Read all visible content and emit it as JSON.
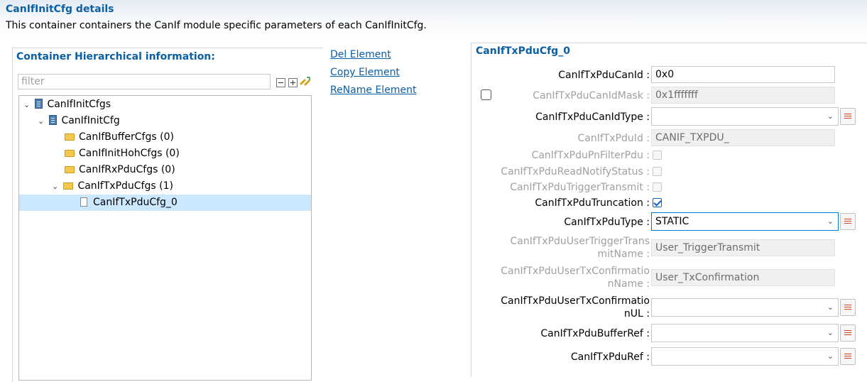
{
  "header": {
    "title": "CanIfInitCfg details",
    "description": "This container containers the CanIf module specific parameters of each CanIfInitCfg."
  },
  "tree_panel": {
    "header": "Container Hierarchical information:",
    "filter_placeholder": "filter",
    "toolbar_icons": [
      "collapse-all-icon",
      "expand-all-icon",
      "link-sync-icon"
    ],
    "items": [
      {
        "label": "CanIfInitCfgs",
        "icon": "config-module-icon",
        "expanded": true
      },
      {
        "label": "CanIfInitCfg",
        "icon": "config-module-icon",
        "expanded": true
      },
      {
        "label": "CanIfBufferCfgs (0)",
        "icon": "folder-icon"
      },
      {
        "label": "CanIfInitHohCfgs (0)",
        "icon": "folder-icon"
      },
      {
        "label": "CanIfRxPduCfgs (0)",
        "icon": "folder-icon"
      },
      {
        "label": "CanIfTxPduCfgs (1)",
        "icon": "folder-icon",
        "expanded": true
      },
      {
        "label": "CanIfTxPduCfg_0",
        "icon": "document-icon",
        "selected": true
      }
    ]
  },
  "actions": {
    "del": "Del Element",
    "copy": "Copy Element",
    "rename": "ReName Element"
  },
  "form": {
    "title": "CanIfTxPduCfg_0",
    "fields": {
      "can_id": {
        "label": "CanIfTxPduCanId :",
        "value": "0x0"
      },
      "can_id_mask": {
        "label": "CanIfTxPduCanIdMask :",
        "value": "0x1fffffff",
        "enabled": false,
        "checked": false
      },
      "can_id_type": {
        "label": "CanIfTxPduCanIdType :",
        "value": ""
      },
      "pdu_id": {
        "label": "CanIfTxPduId :",
        "value": "CANIF_TXPDU_",
        "enabled": false
      },
      "pn_filter": {
        "label": "CanIfTxPduPnFilterPdu :",
        "checked": false,
        "enabled": false
      },
      "read_notify": {
        "label": "CanIfTxPduReadNotifyStatus :",
        "checked": false,
        "enabled": false
      },
      "trigger_transmit": {
        "label": "CanIfTxPduTriggerTransmit :",
        "checked": false,
        "enabled": false
      },
      "truncation": {
        "label": "CanIfTxPduTruncation :",
        "checked": true
      },
      "pdu_type": {
        "label": "CanIfTxPduType :",
        "value": "STATIC"
      },
      "user_trigger_name": {
        "label_line1": "CanIfTxPduUserTriggerTrans",
        "label_line2": "mitName :",
        "value": "User_TriggerTransmit",
        "enabled": false
      },
      "user_txconf_name": {
        "label_line1": "CanIfTxPduUserTxConfirmatio",
        "label_line2": "nName :",
        "value": "User_TxConfirmation",
        "enabled": false
      },
      "user_txconf_ul": {
        "label_line1": "CanIfTxPduUserTxConfirmatio",
        "label_line2": "nUL :",
        "value": ""
      },
      "buffer_ref": {
        "label": "CanIfTxPduBufferRef :",
        "value": ""
      },
      "pdu_ref": {
        "label": "CanIfTxPduRef :",
        "value": ""
      }
    }
  },
  "colors": {
    "accent": "#0b5fa5",
    "selection": "#cce8ff",
    "disabled_text": "#a0a0a0"
  }
}
